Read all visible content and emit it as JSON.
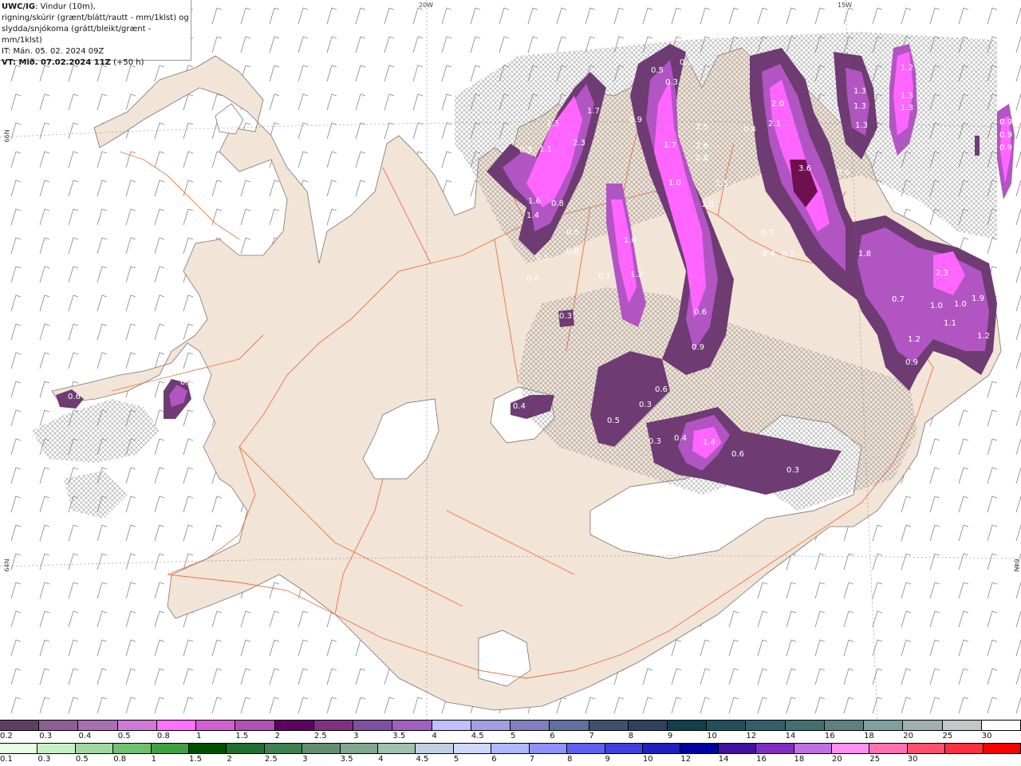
{
  "header": {
    "line1_bold": "UWC/IG",
    "line1_rest": ": Vindur (10m),",
    "line2": "rigning/skúrir (grænt/blátt/rautt - mm/1klst) og",
    "line3": "slydda/snjókoma (grátt/bleikt/grænt - mm/1klst)",
    "line4": "IT: Mán. 05. 02. 2024 09Z",
    "line5_bold": "VT: Mið. 07.02.2024 11Z",
    "line5_rest": " (+50 h)"
  },
  "grid_labels": {
    "lon_20w": "20W",
    "lon_15w": "15W",
    "lat_66n_left": "66N",
    "lat_64n_left": "64N",
    "lat_64n_right": "64N"
  },
  "precip_labels": [
    "0.2",
    "0.5",
    "0.3",
    "1.7",
    "1.3",
    "2.3",
    "0.9",
    "1.7",
    "1.0",
    "2.5",
    "2.8",
    "2.8",
    "1.5",
    "1.8",
    "0.4",
    "2.0",
    "2.1",
    "3.6",
    "0.6",
    "1.3",
    "1.3",
    "1.3",
    "1.2",
    "1.3",
    "1.3",
    "0.9",
    "0.9",
    "0.9",
    "0.3",
    "1.1",
    "1.6",
    "1.4",
    "0.8",
    "0.5",
    "0.8",
    "0.5",
    "0.4",
    "0.7",
    "1.0",
    "1.2",
    "0.3",
    "0.4",
    "0.2",
    "0.6",
    "0.9",
    "1.8",
    "2.3",
    "0.7",
    "1.0",
    "1.0",
    "1.9",
    "1.1",
    "1.2",
    "1.2",
    "0.9",
    "0.3",
    "0.6",
    "0.3",
    "0.5",
    "0.3",
    "0.4",
    "1.4",
    "0.6",
    "0.3",
    "0.4",
    "0.6",
    "0.4"
  ],
  "colors": {
    "land": "#f2e4d6",
    "sea": "#ffffff",
    "roads": "#e8602c",
    "snow_light": "#d77fd8",
    "snow_mid": "#b155c2",
    "snow_dark": "#6e3b73",
    "snow_bright": "#ff66ff"
  },
  "legend_top": {
    "colors": [
      "#5e4064",
      "#8d5f94",
      "#a86fb1",
      "#d07ad8",
      "#ff70ff",
      "#d060d0",
      "#b050b0",
      "#600060",
      "#803080",
      "#8050a0",
      "#a060c0",
      "#c0c0ff",
      "#a0a0e0",
      "#8080c0",
      "#6070a0",
      "#405070",
      "#304060",
      "#104050",
      "#205060",
      "#306070",
      "#407070",
      "#608080",
      "#80a0a0",
      "#a0b0b0",
      "#c0c8c8",
      "#ffffff"
    ],
    "ticks": [
      "0.2",
      "0.3",
      "0.4",
      "0.5",
      "0.8",
      "1",
      "1.5",
      "2",
      "2.5",
      "3",
      "3.5",
      "4",
      "4.5",
      "5",
      "6",
      "7",
      "8",
      "9",
      "10",
      "12",
      "14",
      "16",
      "18",
      "20",
      "25",
      "30"
    ]
  },
  "legend_bottom": {
    "colors": [
      "#e6ffe6",
      "#c8f0c8",
      "#a0d8a0",
      "#70c070",
      "#40a040",
      "#005000",
      "#207030",
      "#408050",
      "#609070",
      "#80a890",
      "#a0c0b0",
      "#c0d0e0",
      "#d0d8ff",
      "#b0b8ff",
      "#9090ff",
      "#6060f0",
      "#4040e0",
      "#2020c0",
      "#0000a0",
      "#4010a0",
      "#8030c0",
      "#c070e0",
      "#ff90f0",
      "#ff70b0",
      "#ff5070",
      "#ff3040",
      "#ff0000"
    ],
    "ticks": [
      "0.1",
      "0.3",
      "0.5",
      "0.8",
      "1",
      "1.5",
      "2",
      "2.5",
      "3",
      "3.5",
      "4",
      "4.5",
      "5",
      "6",
      "7",
      "8",
      "9",
      "10",
      "12",
      "14",
      "16",
      "18",
      "20",
      "25",
      "30"
    ]
  }
}
